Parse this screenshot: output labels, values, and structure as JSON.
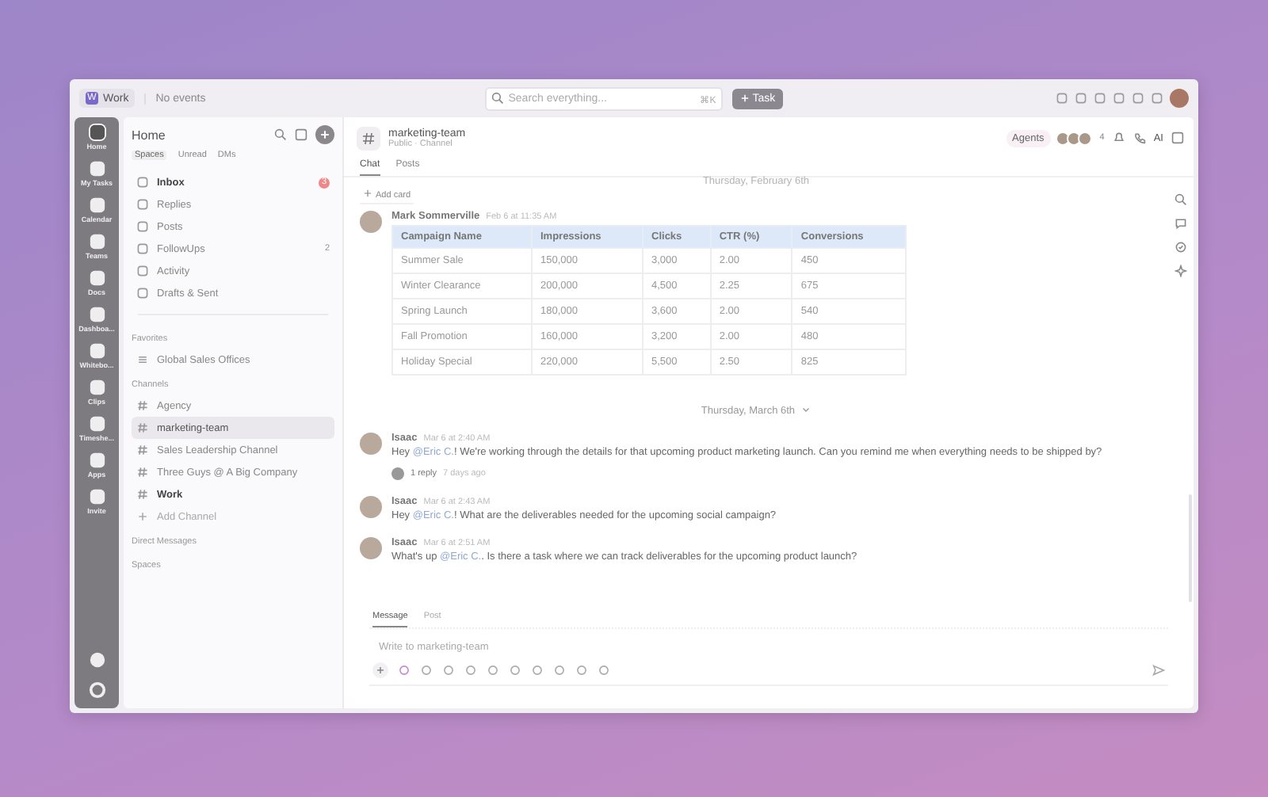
{
  "topbar": {
    "workspace_logo": "W",
    "workspace": "Work",
    "events": "No events",
    "search": {
      "placeholder": "Search everything..."
    },
    "shortcut": "⌘K",
    "task_button": "Task"
  },
  "rail": {
    "items": [
      {
        "label": "Home",
        "selected": true
      },
      {
        "label": "My Tasks",
        "selected": false
      },
      {
        "label": "Calendar",
        "selected": false
      },
      {
        "label": "Teams",
        "selected": false
      },
      {
        "label": "Docs",
        "selected": false
      },
      {
        "label": "Dashboa...",
        "selected": false
      },
      {
        "label": "Whitebo...",
        "selected": false
      },
      {
        "label": "Clips",
        "selected": false
      },
      {
        "label": "Timeshe...",
        "selected": false
      },
      {
        "label": "Apps",
        "selected": false
      },
      {
        "label": "Invite",
        "selected": false
      }
    ]
  },
  "sidebar": {
    "title": "Home",
    "tabs": [
      {
        "label": "Spaces",
        "selected": true
      },
      {
        "label": "Unread",
        "selected": false
      },
      {
        "label": "DMs",
        "selected": false
      }
    ],
    "items": [
      {
        "label": "Inbox",
        "count": "3",
        "unread": true
      },
      {
        "label": "Replies",
        "unread": false
      },
      {
        "label": "Posts",
        "unread": false
      },
      {
        "label": "FollowUps",
        "count": "2",
        "unread": false
      },
      {
        "label": "Activity",
        "unread": false
      },
      {
        "label": "Drafts & Sent",
        "unread": false
      }
    ],
    "favorites": {
      "heading": "Favorites",
      "items": [
        {
          "label": "Global Sales Offices"
        }
      ]
    },
    "channels": {
      "heading": "Channels",
      "items": [
        {
          "label": "Agency",
          "selected": false,
          "unread": false
        },
        {
          "label": "marketing-team",
          "selected": true,
          "unread": false
        },
        {
          "label": "Sales Leadership Channel",
          "selected": false,
          "unread": false
        },
        {
          "label": "Three Guys @ A Big Company",
          "selected": false,
          "unread": false
        },
        {
          "label": "Work",
          "selected": false,
          "unread": true
        }
      ],
      "add": "Add Channel"
    },
    "direct_messages": "Direct Messages",
    "spaces": "Spaces"
  },
  "channel": {
    "name": "marketing-team",
    "subtitle": "Public · Channel",
    "tabs": [
      {
        "label": "Chat",
        "selected": true
      },
      {
        "label": "Posts",
        "selected": false
      }
    ],
    "agents": "Agents",
    "member_count": "4",
    "ai": "AI"
  },
  "feed": {
    "faded_date": "Thursday, February 6th",
    "add_card": "Add card",
    "first": {
      "author": "Mark Sommerville",
      "time": "Feb 6 at 11:35 AM",
      "table": {
        "columns": [
          "Campaign Name",
          "Impressions",
          "Clicks",
          "CTR (%)",
          "Conversions"
        ],
        "rows": [
          [
            "Summer Sale",
            "150,000",
            "3,000",
            "2.00",
            "450"
          ],
          [
            "Winter Clearance",
            "200,000",
            "4,500",
            "2.25",
            "675"
          ],
          [
            "Spring Launch",
            "180,000",
            "3,600",
            "2.00",
            "540"
          ],
          [
            "Fall Promotion",
            "160,000",
            "3,200",
            "2.00",
            "480"
          ],
          [
            "Holiday Special",
            "220,000",
            "5,500",
            "2.50",
            "825"
          ]
        ]
      }
    },
    "date": "Thursday, March 6th",
    "messages": [
      {
        "author": "Isaac",
        "time": "Mar 6 at 2:40 AM",
        "before": "Hey ",
        "mention": "@Eric C.",
        "after": "! We're working through the details for that upcoming product marketing launch. Can you remind me when everything needs to be shipped by?",
        "replies": "1 reply",
        "reply_time": "7 days ago"
      },
      {
        "author": "Isaac",
        "time": "Mar 6 at 2:43 AM",
        "before": "Hey ",
        "mention": "@Eric C.",
        "after": "! What are the deliverables needed for the upcoming social campaign?"
      },
      {
        "author": "Isaac",
        "time": "Mar 6 at 2:51 AM",
        "before": "What's up ",
        "mention": "@Eric C.",
        "after": ". Is there a task where we can track deliverables for the upcoming product launch?"
      }
    ]
  },
  "composer": {
    "tabs": [
      {
        "label": "Message",
        "selected": true
      },
      {
        "label": "Post",
        "selected": false
      }
    ],
    "placeholder": "Write to marketing-team"
  }
}
